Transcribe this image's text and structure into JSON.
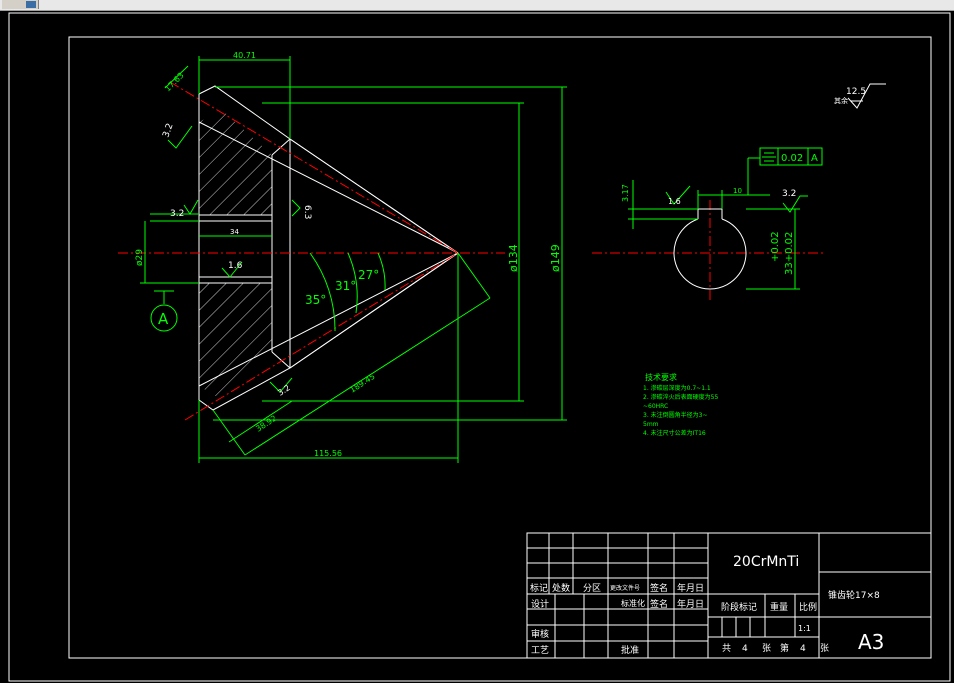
{
  "drawing": {
    "dims": {
      "top_width": "40.71",
      "slant_top": "17.63",
      "bore_depth": "34",
      "bore_dia": "ø29",
      "dia_134": "ø134",
      "dia_149": "ø149",
      "angle_35": "35°",
      "angle_31": "31°",
      "angle_27": "27°",
      "slant_long": "189.45",
      "slant_small": "38.92",
      "bottom_width": "115.56",
      "keyway_depth": "3.17",
      "keyway_width": "10",
      "key_tol_top": "+0.02",
      "key_tol_main": "33+0.02"
    },
    "roughness": {
      "r_top_left": "3.2",
      "r_bore_top": "3.2",
      "r_face": "6.3",
      "r_bore": "1.6",
      "r_small": "3.2",
      "r_general": "12.5",
      "r_general_note": "其余",
      "r_key_left": "1.6",
      "r_key_right": "3.2"
    },
    "datum_label": "A",
    "tolerance": {
      "value": "0.02",
      "datum": "A"
    },
    "tech": {
      "heading": "技术要求",
      "line1": "1. 渗碳层深度为0.7~1.1",
      "line2": "2. 渗碳淬火后表面硬度为55",
      "line2b": "~60HRC",
      "line3": "3. 未注倒圆角半径为3~",
      "line3b": "5mm",
      "line4": "4. 未注尺寸公差为IT16"
    }
  },
  "title_block": {
    "material": "20CrMnTi",
    "part_name": "锥齿轮17×8",
    "sheet_size": "A3",
    "row_labels": {
      "biaoji": "标记",
      "chushu": "处数",
      "fenqu": "分区",
      "gengai": "更改文件号",
      "qianming": "签名",
      "nianyueri": "年月日"
    },
    "sheji": "设计",
    "biaozhunhua": "标准化",
    "qianming2": "签名",
    "nianyueri2": "年月日",
    "jieduan": "阶段标记",
    "zhongliang": "重量",
    "bili": "比例",
    "scale_value": "1:1",
    "shenhe": "审核",
    "gongyi": "工艺",
    "pizhun": "批准",
    "gong": "共",
    "total": "4",
    "zhang": "张",
    "di": "第",
    "sheet_no": "4",
    "zhang2": "张"
  }
}
